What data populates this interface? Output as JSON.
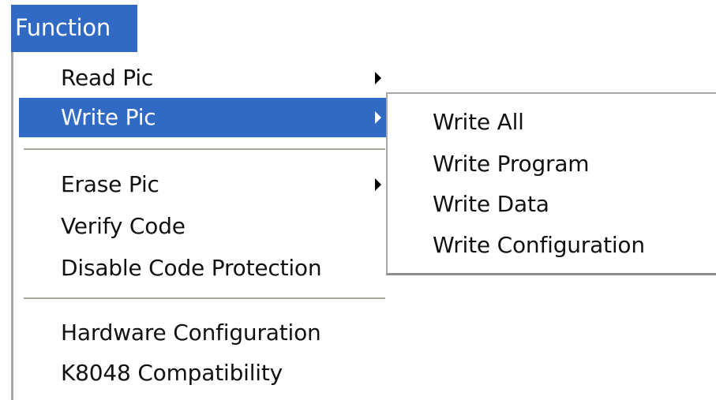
{
  "menubar": {
    "function_label": "Function"
  },
  "dropdown": {
    "items": [
      {
        "label": "Read Pic",
        "has_submenu": true
      },
      {
        "label": "Write Pic",
        "has_submenu": true,
        "highlighted": true
      },
      {
        "label": "Erase Pic",
        "has_submenu": true
      },
      {
        "label": "Verify Code",
        "has_submenu": false
      },
      {
        "label": "Disable Code Protection",
        "has_submenu": false
      },
      {
        "label": "Hardware Configuration",
        "has_submenu": false
      },
      {
        "label": "K8048 Compatibility",
        "has_submenu": false
      }
    ]
  },
  "submenu": {
    "items": [
      {
        "label": "Write All"
      },
      {
        "label": "Write Program"
      },
      {
        "label": "Write Data"
      },
      {
        "label": "Write Configuration"
      }
    ]
  },
  "colors": {
    "highlight": "#316ac5",
    "highlight_text": "#ffffff",
    "menu_text": "#111111",
    "separator": "#aca899"
  }
}
